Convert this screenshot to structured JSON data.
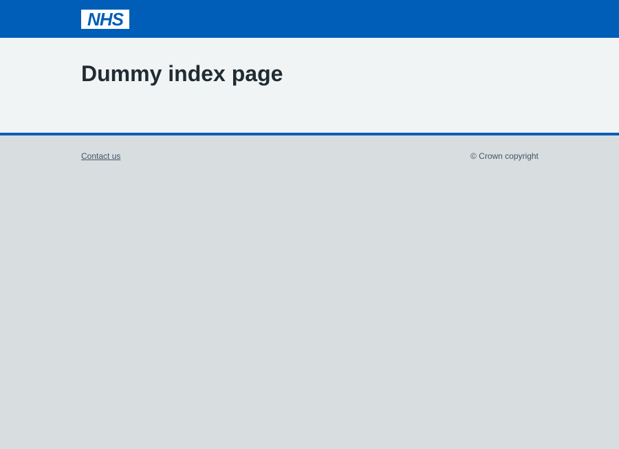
{
  "header": {
    "logo_text": "NHS",
    "logo_bg_color": "#ffffff",
    "brand_color": "#005eb8"
  },
  "main": {
    "title": "Dummy index page"
  },
  "footer": {
    "contact_label": "Contact us",
    "copyright": "© Crown copyright"
  }
}
